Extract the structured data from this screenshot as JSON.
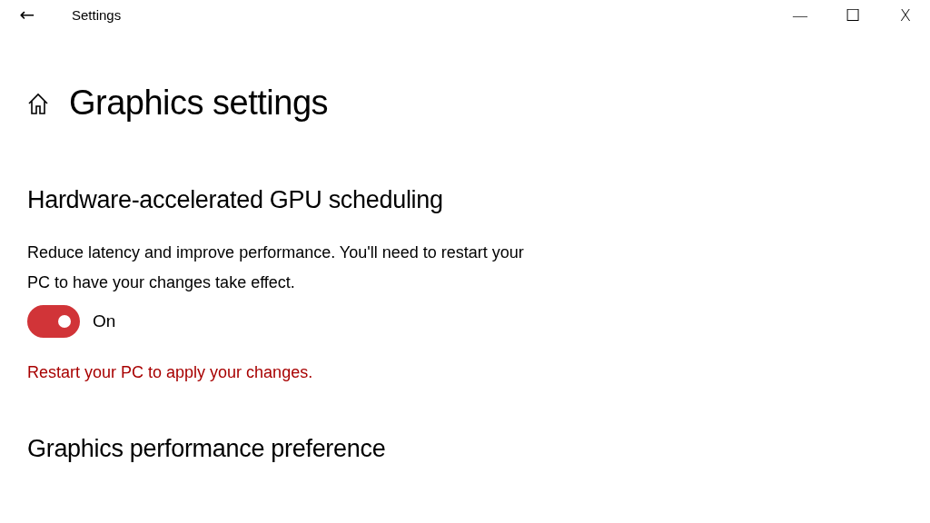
{
  "window": {
    "title": "Settings",
    "back_button": "←",
    "controls": [
      "—",
      "☐",
      "X"
    ]
  },
  "page": {
    "title": "Graphics settings"
  },
  "sections": [
    {
      "kind": "toggle",
      "heading": "Hardware-accelerated GPU scheduling",
      "description": "Reduce latency and improve performance. You'll need to restart your PC to have your changes take effect.",
      "toggle": {
        "on": true,
        "label": "On"
      },
      "notice": "Restart your PC to apply your changes."
    },
    {
      "kind": "heading",
      "heading": "Graphics performance preference"
    }
  ]
}
